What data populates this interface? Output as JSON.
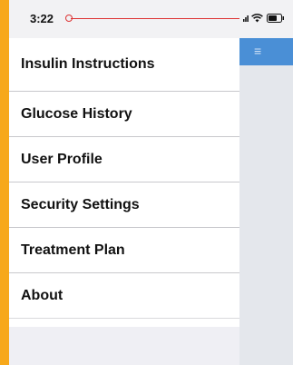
{
  "status_bar": {
    "time": "3:22"
  },
  "menu": {
    "items": [
      {
        "label": "Insulin Instructions"
      },
      {
        "label": "Glucose History"
      },
      {
        "label": "User Profile"
      },
      {
        "label": "Security Settings"
      },
      {
        "label": "Treatment Plan"
      },
      {
        "label": "About"
      }
    ]
  },
  "background_app": {
    "header_color": "#4a8fd6",
    "menu_icon": "hamburger-icon"
  },
  "colors": {
    "frame": "#f7a81b",
    "timeline": "#dd3333"
  }
}
